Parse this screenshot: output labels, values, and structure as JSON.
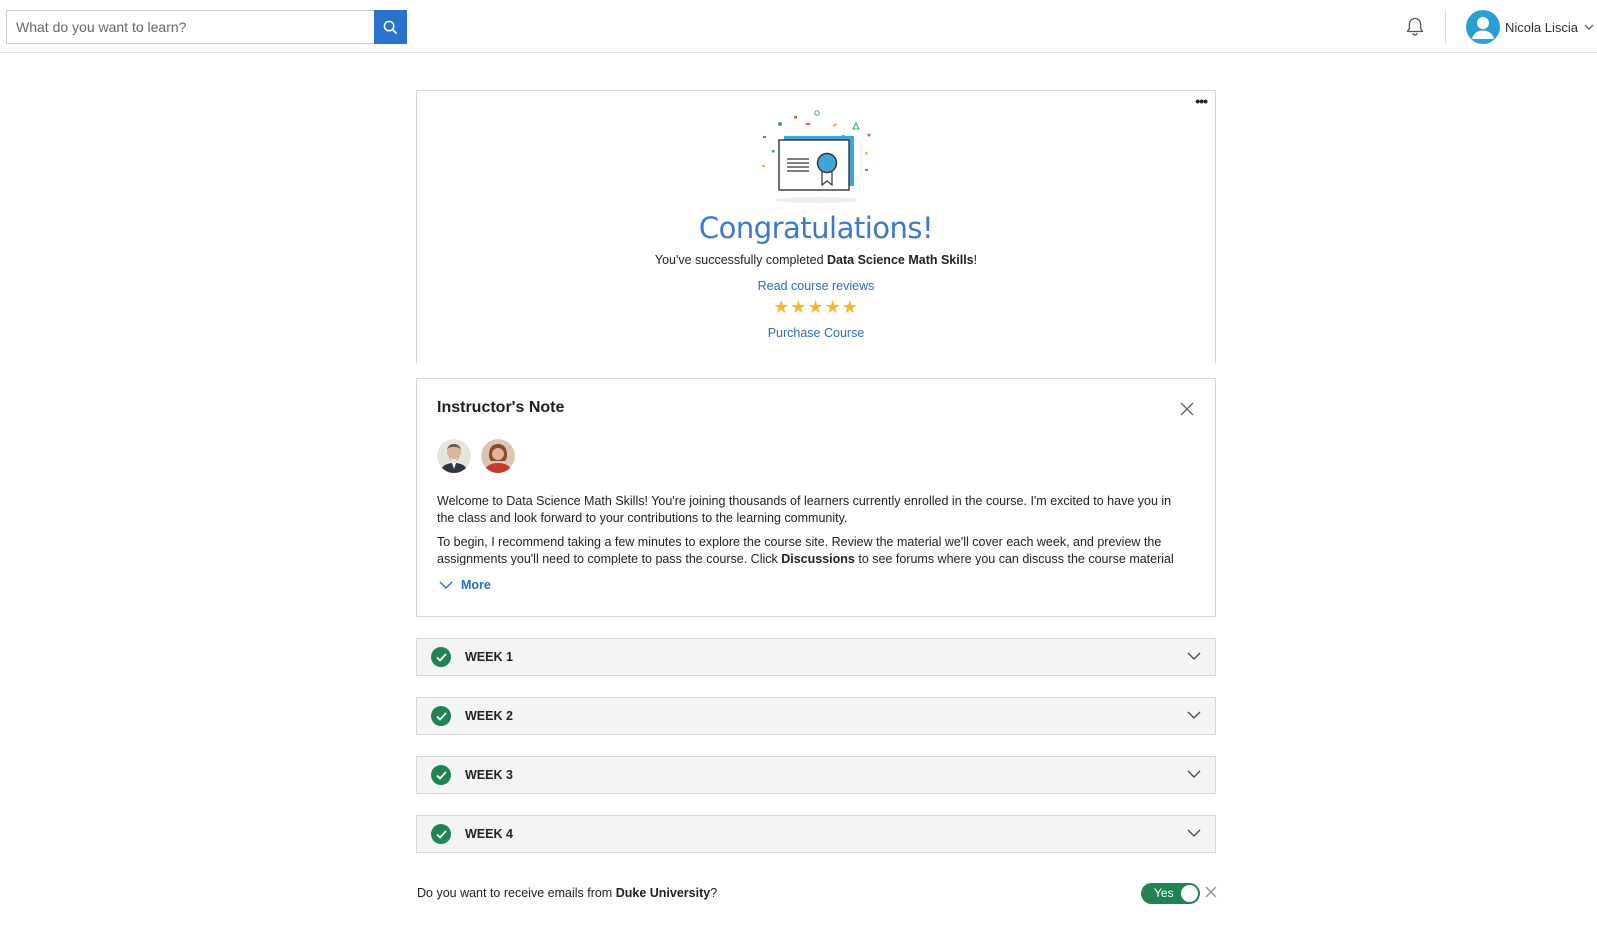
{
  "search": {
    "placeholder": "What do you want to learn?"
  },
  "user": {
    "name": "Nicola Liscia"
  },
  "congrats": {
    "title": "Congratulations!",
    "text_prefix": "You've successfully completed ",
    "course_name": "Data Science Math Skills",
    "text_suffix": "!",
    "reviews_link": "Read course reviews",
    "rating_stars": 5,
    "stars": "★★★★★",
    "purchase_link": "Purchase Course"
  },
  "note": {
    "title": "Instructor's Note",
    "paragraph1": "Welcome to Data Science Math Skills! You're joining thousands of learners currently enrolled in the course. I'm excited to have you in the class and look forward to your contributions to the learning community.",
    "paragraph2_prefix": "To begin, I recommend taking a few minutes to explore the course site. Review the material we'll cover each week, and preview the assignments you'll need to complete to pass the course. Click ",
    "paragraph2_bold": "Discussions",
    "paragraph2_suffix": " to see forums where you can discuss the course material with",
    "more_label": "More"
  },
  "weeks": [
    {
      "label": "WEEK 1",
      "completed": true
    },
    {
      "label": "WEEK 2",
      "completed": true
    },
    {
      "label": "WEEK 3",
      "completed": true
    },
    {
      "label": "WEEK 4",
      "completed": true
    }
  ],
  "email_prompt": {
    "prefix": "Do you want to receive emails from ",
    "org": "Duke University",
    "suffix": "?",
    "toggle_label": "Yes"
  },
  "colors": {
    "accent": "#2a73cc",
    "link": "#2a6ebb",
    "success": "#1f8354",
    "star": "#f5b731"
  }
}
